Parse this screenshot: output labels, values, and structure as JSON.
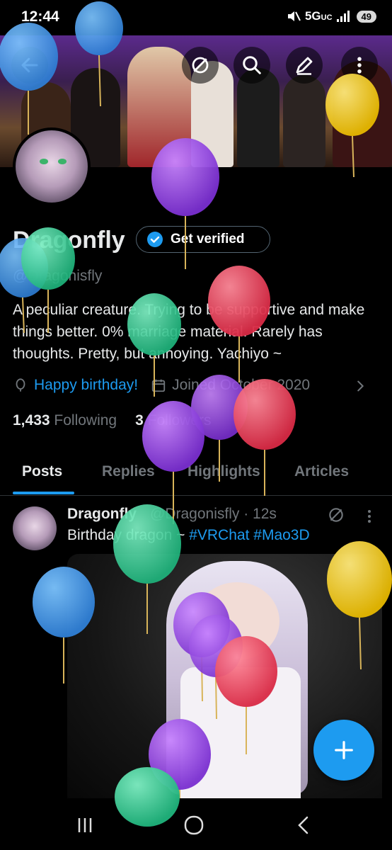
{
  "status_bar": {
    "time": "12:44",
    "network": "5G",
    "network_sub": "UC",
    "battery": "49"
  },
  "header": {
    "back_icon": "arrow-left-icon",
    "grok_icon": "grok-icon",
    "search_icon": "search-icon",
    "compose_icon": "pencil-icon",
    "more_icon": "more-vertical-icon"
  },
  "profile": {
    "name": "Dragonfly",
    "verify_label": "Get verified",
    "handle": "@Dragonisfly",
    "bio": "A peculiar creature. Trying to be supportive and make things better. 0% marriage material. Rarely has thoughts. Pretty, but annoying. Yachiyo ~",
    "birthday_text": "Happy birthday!",
    "joined_text": "Joined October 2020",
    "following_count": "1,433",
    "following_label": "Following",
    "followers_count": "3",
    "followers_label": "Followers"
  },
  "tabs": [
    "Posts",
    "Replies",
    "Highlights",
    "Articles"
  ],
  "active_tab": "Posts",
  "post": {
    "author": "Dragonfly",
    "meta": "@Dragonisfly · 12s",
    "text_prefix": "Birthday dragon ~ ",
    "hashtag_1": "#VRChat",
    "hashtag_2": "#Mao3D"
  },
  "fab_icon": "plus-icon",
  "nav": {
    "recent_icon": "recents-icon",
    "home_icon": "home-circle-icon",
    "back_icon": "back-chevron-icon"
  },
  "colors": {
    "accent": "#1d9bf0",
    "muted": "#71767b",
    "text": "#e7e9ea"
  }
}
